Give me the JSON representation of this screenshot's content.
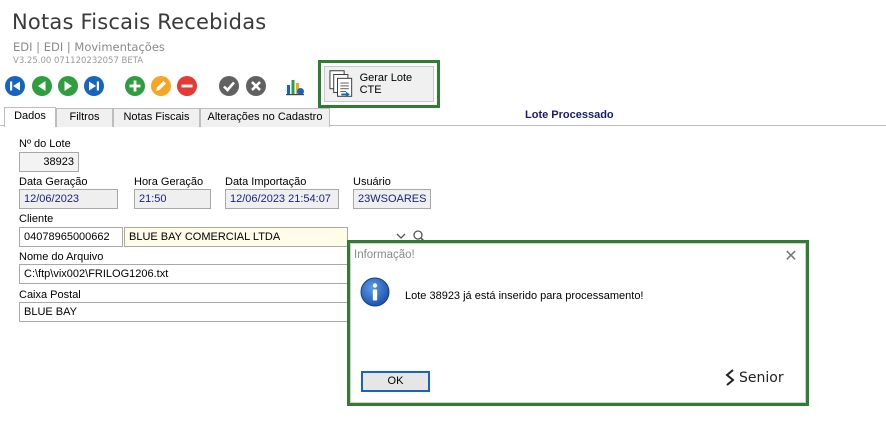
{
  "header": {
    "title": "Notas Fiscais Recebidas",
    "breadcrumb": "EDI | EDI | Movimentações",
    "version": "V3.25.00 071120232057 BETA"
  },
  "toolbar": {
    "buttons": [
      {
        "icon": "first-record-icon",
        "color": "#1565c0"
      },
      {
        "icon": "previous-record-icon",
        "color": "#2e9e3e"
      },
      {
        "icon": "next-record-icon",
        "color": "#2e9e3e"
      },
      {
        "icon": "last-record-icon",
        "color": "#1565c0"
      },
      {
        "icon": "add-icon",
        "color": "#2e9e3e"
      },
      {
        "icon": "edit-icon",
        "color": "#f5a623"
      },
      {
        "icon": "delete-icon",
        "color": "#e53935"
      },
      {
        "icon": "confirm-icon",
        "color": "#616161"
      },
      {
        "icon": "cancel-icon",
        "color": "#616161"
      },
      {
        "icon": "report-chart-icon",
        "color": "#1565c0"
      }
    ],
    "gerar_lote_label": "Gerar Lote CTE"
  },
  "tabs": [
    {
      "label": "Dados",
      "active": true
    },
    {
      "label": "Filtros",
      "active": false
    },
    {
      "label": "Notas Fiscais",
      "active": false
    },
    {
      "label": "Alterações no Cadastro",
      "active": false
    }
  ],
  "status_label": "Lote Processado",
  "form": {
    "lote_label": "Nº do Lote",
    "lote_value": "38923",
    "data_geracao_label": "Data Geração",
    "data_geracao_value": "12/06/2023",
    "hora_geracao_label": "Hora Geração",
    "hora_geracao_value": "21:50",
    "data_importacao_label": "Data Importação",
    "data_importacao_value": "12/06/2023 21:54:07",
    "usuario_label": "Usuário",
    "usuario_value": "23WSOARES",
    "cliente_label": "Cliente",
    "cliente_code": "04078965000662",
    "cliente_name": "BLUE BAY COMERCIAL LTDA",
    "arquivo_label": "Nome do Arquivo",
    "arquivo_value": "C:\\ftp\\vix002\\FRILOG1206.txt",
    "caixa_label": "Caixa Postal",
    "caixa_value": "BLUE BAY"
  },
  "dialog": {
    "title": "Informação!",
    "close": "✕",
    "message": "Lote 38923 já está inserido para processamento!",
    "ok_label": "OK",
    "brand": "Senior"
  },
  "colors": {
    "highlight_border": "#2e7d32",
    "status_text": "#1b1b6e",
    "ok_border": "#1565c0"
  }
}
